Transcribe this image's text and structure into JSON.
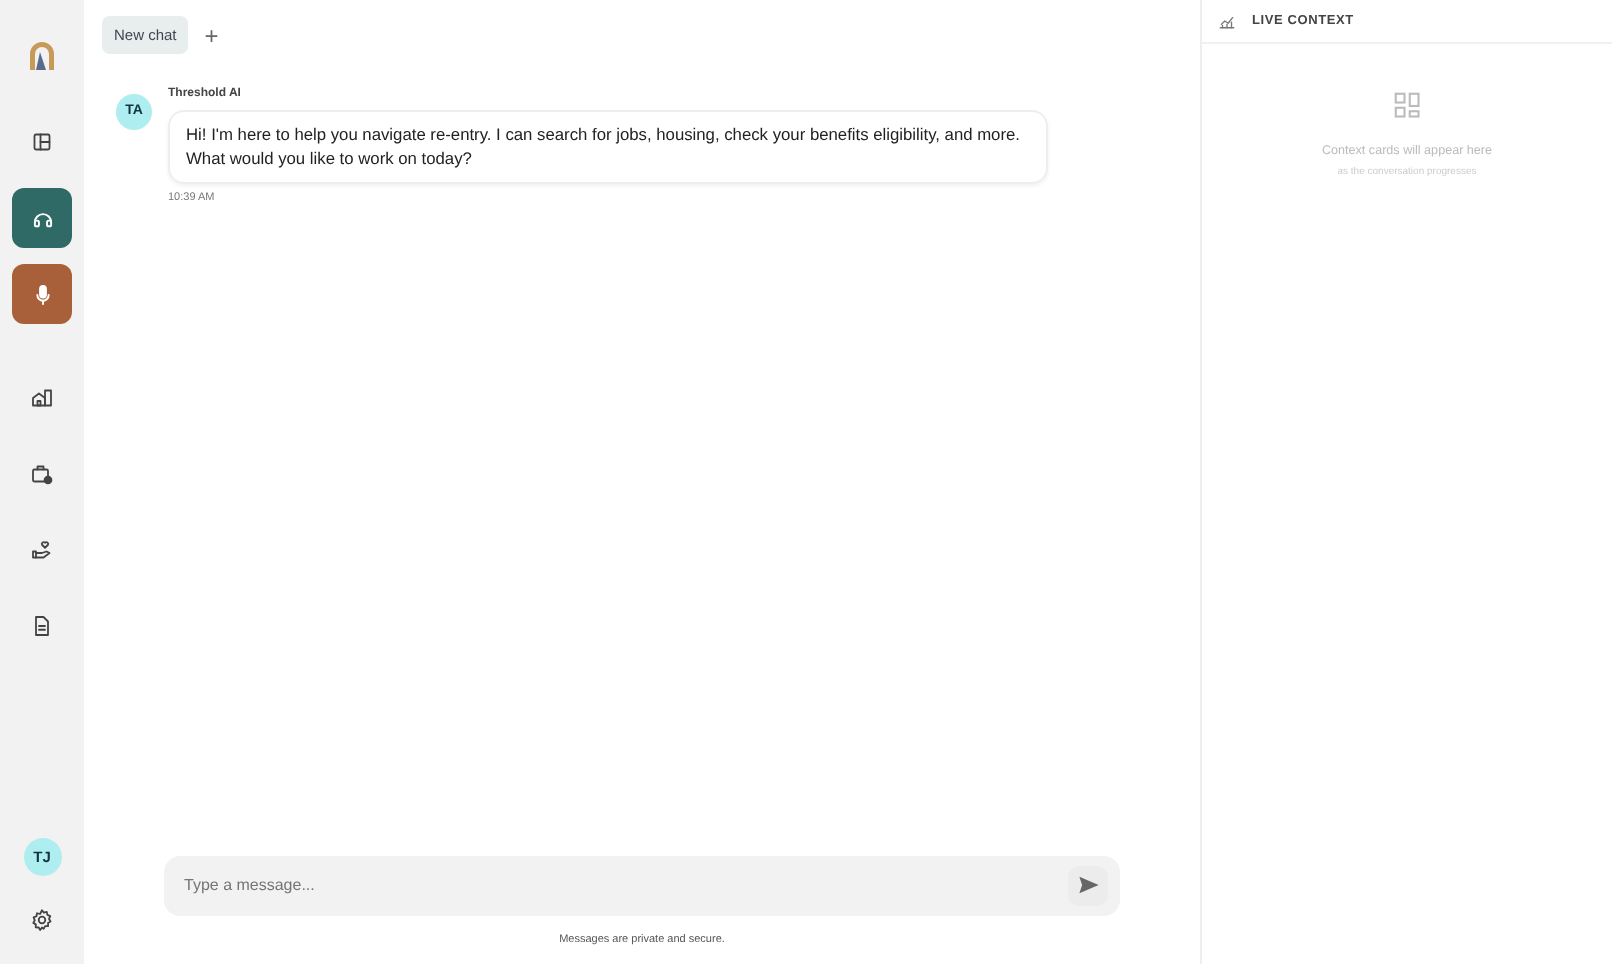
{
  "sidebar": {
    "items": [
      {
        "kind": "nav",
        "selected": false
      },
      {
        "kind": "nav",
        "selected": true
      },
      {
        "kind": "voice",
        "selected": false
      },
      {
        "kind": "nav",
        "selected": false
      },
      {
        "kind": "nav",
        "selected": false
      },
      {
        "kind": "nav",
        "selected": false
      },
      {
        "kind": "nav",
        "selected": false
      }
    ],
    "user_initials": "TJ"
  },
  "tabs": [
    {
      "label": "New chat",
      "selected": true
    }
  ],
  "new_tab": "+",
  "messages": [
    {
      "avatar": "TA",
      "sender": "Threshold AI",
      "text": "Hi! I'm here to help you navigate re-entry. I can search for jobs, housing, check your benefits eligibility, and more. What would you like to work on today?",
      "time": "10:39 AM"
    }
  ],
  "composer": {
    "placeholder": "Type a message...",
    "note": "Messages are private and secure."
  },
  "context_panel": {
    "title": "LIVE CONTEXT",
    "empty_title": "Context cards will appear here",
    "empty_subtitle": "as the conversation progresses"
  }
}
